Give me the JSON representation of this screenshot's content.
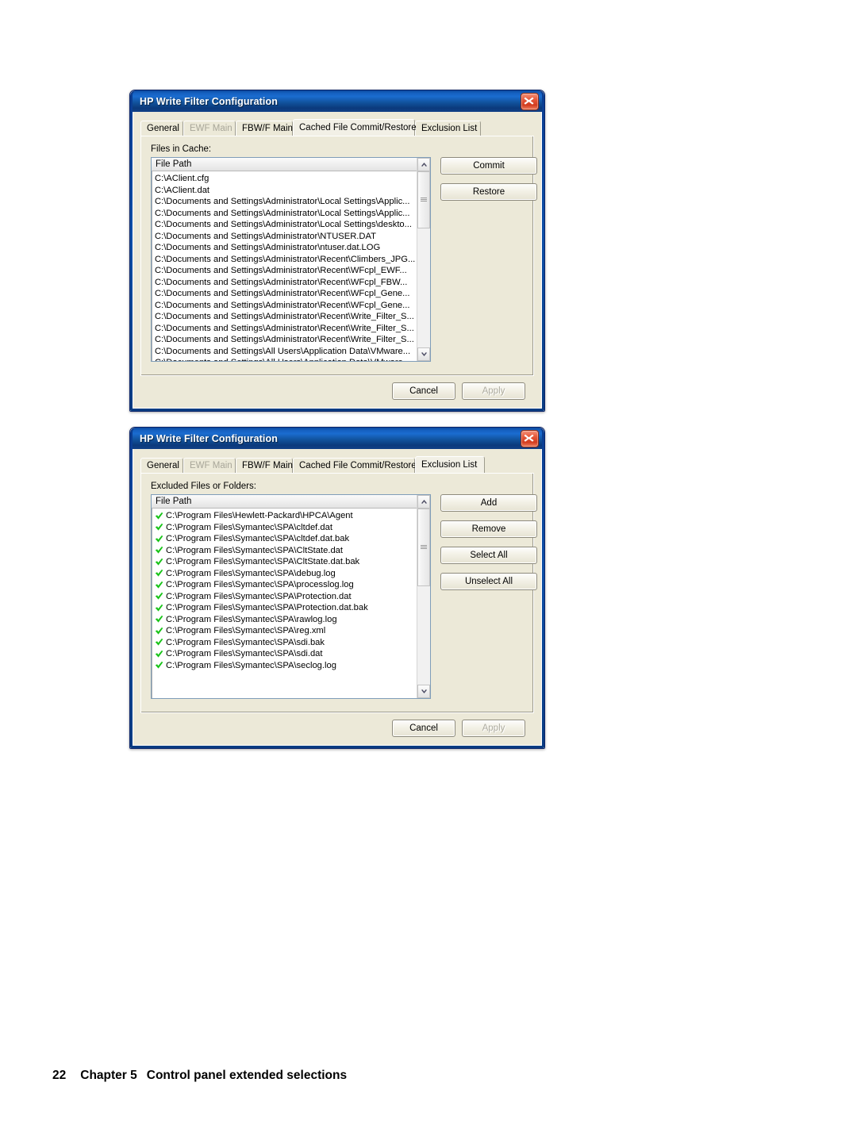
{
  "page": {
    "footer": {
      "page_number": "22",
      "chapter": "Chapter 5",
      "title": "Control panel extended selections"
    }
  },
  "colors": {
    "titlebar": "#1560c0",
    "dialog_face": "#ece9d8",
    "close_button": "#d23c1f",
    "checkmark_green": "#19c419",
    "list_background": "#ffffff"
  },
  "dialogs": [
    {
      "id": "cached-file-commit-restore",
      "title": "HP Write Filter Configuration",
      "close_icon": "close-icon",
      "tabs": [
        {
          "label": "General",
          "state": "normal"
        },
        {
          "label": "EWF Main",
          "state": "disabled"
        },
        {
          "label": "FBW/F Main",
          "state": "normal"
        },
        {
          "label": "Cached File Commit/Restore",
          "state": "active"
        },
        {
          "label": "Exclusion List",
          "state": "normal"
        }
      ],
      "field_label": "Files in Cache:",
      "list": {
        "column_header": "File Path",
        "has_checkmarks": false,
        "rows": [
          "C:\\AClient.cfg",
          "C:\\AClient.dat",
          "C:\\Documents and Settings\\Administrator\\Local Settings\\Applic...",
          "C:\\Documents and Settings\\Administrator\\Local Settings\\Applic...",
          "C:\\Documents and Settings\\Administrator\\Local Settings\\deskto...",
          "C:\\Documents and Settings\\Administrator\\NTUSER.DAT",
          "C:\\Documents and Settings\\Administrator\\ntuser.dat.LOG",
          "C:\\Documents and Settings\\Administrator\\Recent\\Climbers_JPG...",
          "C:\\Documents and Settings\\Administrator\\Recent\\WFcpl_EWF...",
          "C:\\Documents and Settings\\Administrator\\Recent\\WFcpl_FBW...",
          "C:\\Documents and Settings\\Administrator\\Recent\\WFcpl_Gene...",
          "C:\\Documents and Settings\\Administrator\\Recent\\WFcpl_Gene...",
          "C:\\Documents and Settings\\Administrator\\Recent\\Write_Filter_S...",
          "C:\\Documents and Settings\\Administrator\\Recent\\Write_Filter_S...",
          "C:\\Documents and Settings\\Administrator\\Recent\\Write_Filter_S...",
          "C:\\Documents and Settings\\All Users\\Application Data\\VMware...",
          "C:\\Documents and Settings\\All Users\\Application Data\\VMware..."
        ],
        "scrollbar": {
          "up_icon": "chevron-up-icon",
          "down_icon": "chevron-down-icon",
          "thumb_position": "top"
        }
      },
      "side_buttons": [
        {
          "label": "Commit",
          "state": "normal"
        },
        {
          "label": "Restore",
          "state": "normal"
        }
      ],
      "footer_buttons": [
        {
          "label": "Cancel",
          "state": "normal"
        },
        {
          "label": "Apply",
          "state": "disabled"
        }
      ]
    },
    {
      "id": "exclusion-list",
      "title": "HP Write Filter Configuration",
      "close_icon": "close-icon",
      "tabs": [
        {
          "label": "General",
          "state": "normal"
        },
        {
          "label": "EWF Main",
          "state": "disabled"
        },
        {
          "label": "FBW/F Main",
          "state": "normal"
        },
        {
          "label": "Cached File Commit/Restore",
          "state": "normal"
        },
        {
          "label": "Exclusion List",
          "state": "active"
        }
      ],
      "field_label": "Excluded Files or Folders:",
      "list": {
        "column_header": "File Path",
        "has_checkmarks": true,
        "rows": [
          "C:\\Program Files\\Hewlett-Packard\\HPCA\\Agent",
          "C:\\Program Files\\Symantec\\SPA\\cltdef.dat",
          "C:\\Program Files\\Symantec\\SPA\\cltdef.dat.bak",
          "C:\\Program Files\\Symantec\\SPA\\CltState.dat",
          "C:\\Program Files\\Symantec\\SPA\\CltState.dat.bak",
          "C:\\Program Files\\Symantec\\SPA\\debug.log",
          "C:\\Program Files\\Symantec\\SPA\\processlog.log",
          "C:\\Program Files\\Symantec\\SPA\\Protection.dat",
          "C:\\Program Files\\Symantec\\SPA\\Protection.dat.bak",
          "C:\\Program Files\\Symantec\\SPA\\rawlog.log",
          "C:\\Program Files\\Symantec\\SPA\\reg.xml",
          "C:\\Program Files\\Symantec\\SPA\\sdi.bak",
          "C:\\Program Files\\Symantec\\SPA\\sdi.dat",
          "C:\\Program Files\\Symantec\\SPA\\seclog.log"
        ],
        "scrollbar": {
          "up_icon": "chevron-up-icon",
          "down_icon": "chevron-down-icon",
          "thumb_position": "top"
        }
      },
      "side_buttons": [
        {
          "label": "Add",
          "state": "normal"
        },
        {
          "label": "Remove",
          "state": "normal"
        },
        {
          "label": "Select All",
          "state": "normal"
        },
        {
          "label": "Unselect All",
          "state": "normal"
        }
      ],
      "footer_buttons": [
        {
          "label": "Cancel",
          "state": "normal"
        },
        {
          "label": "Apply",
          "state": "disabled"
        }
      ]
    }
  ]
}
